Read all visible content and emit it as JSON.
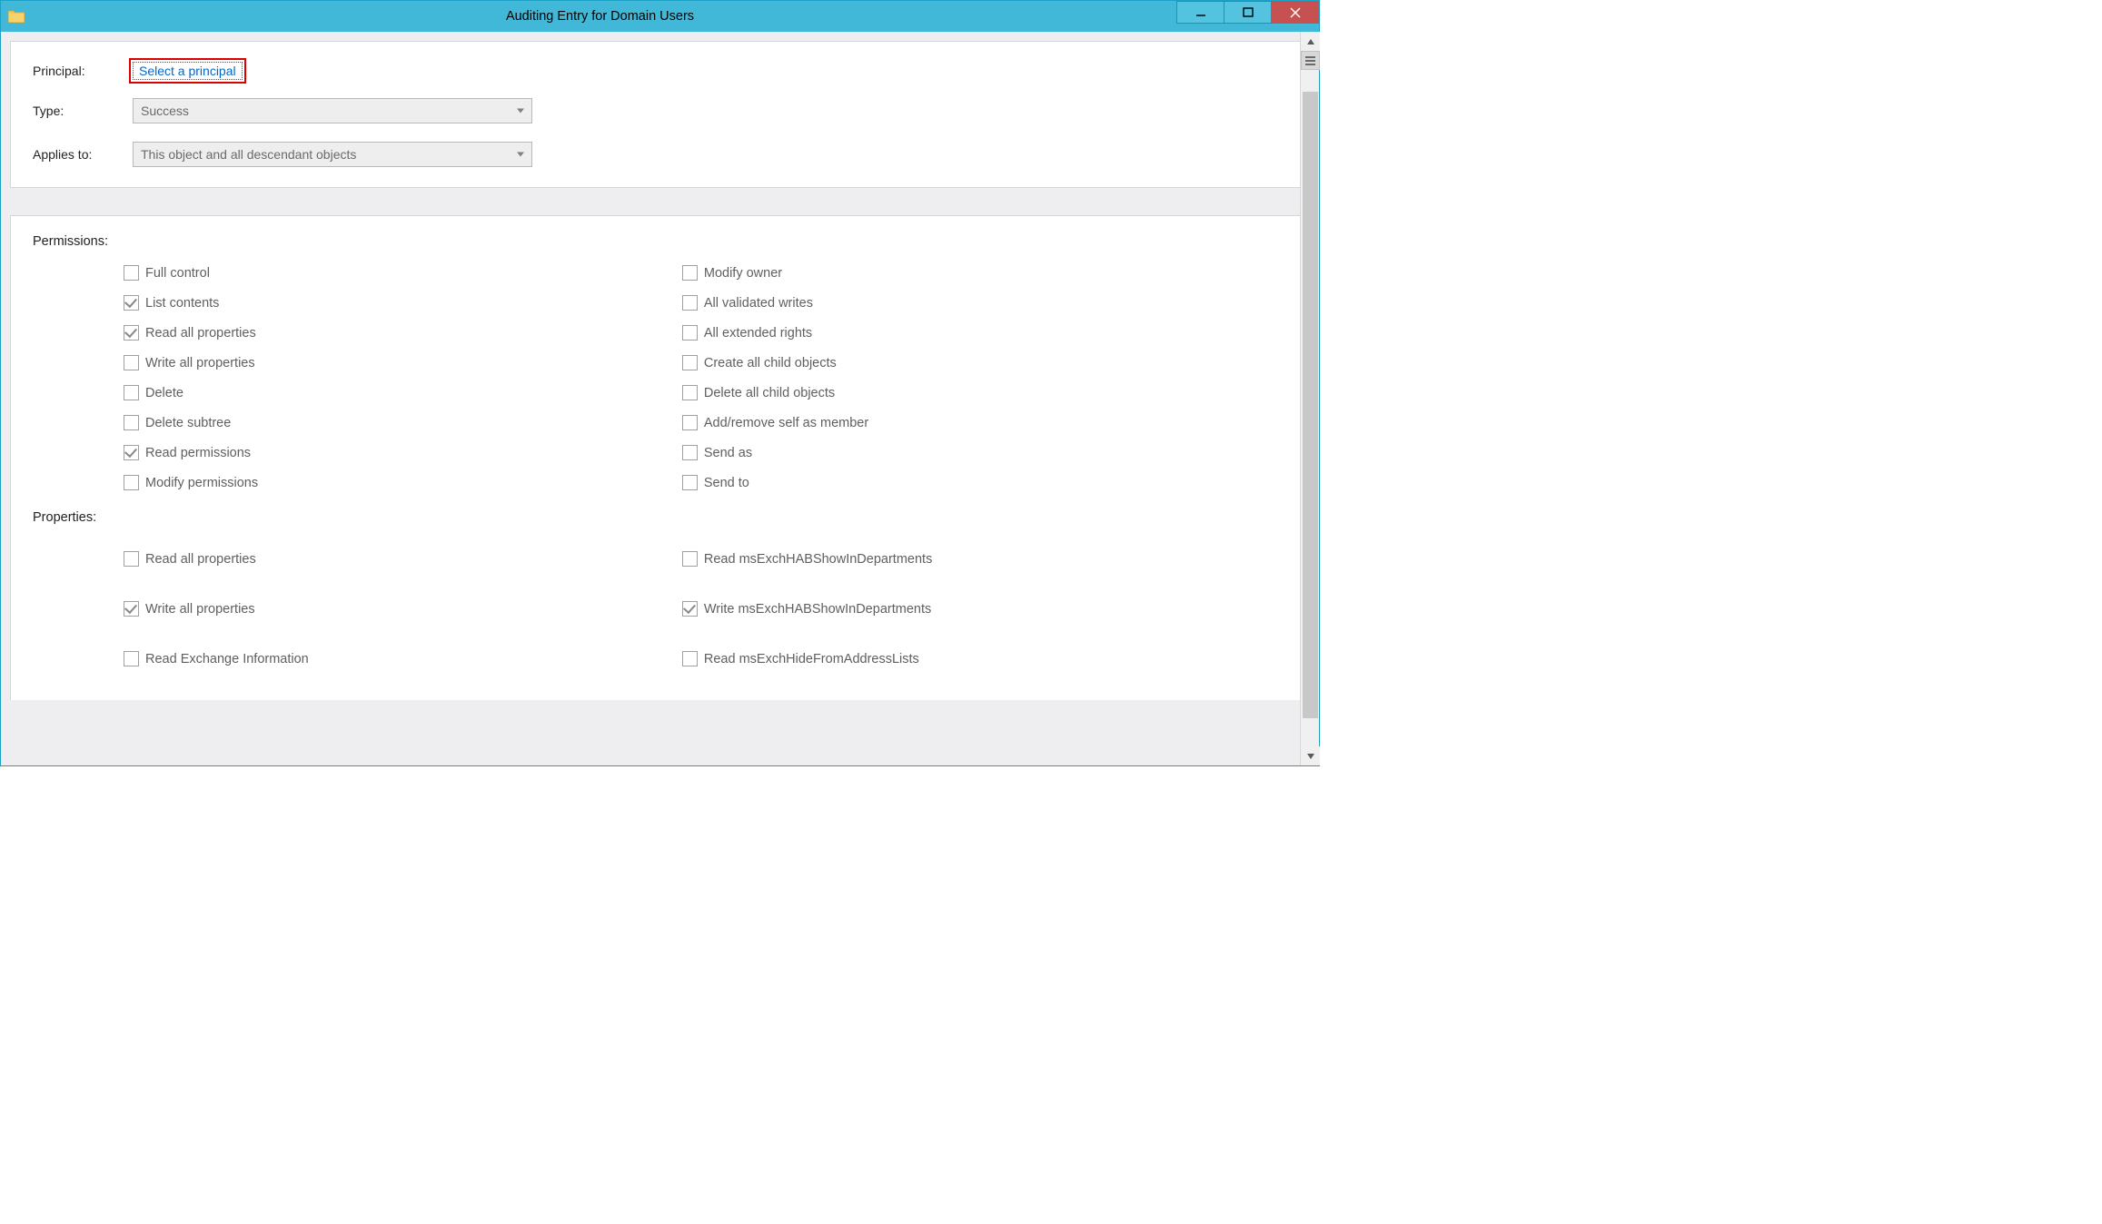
{
  "window": {
    "title": "Auditing Entry for Domain Users"
  },
  "principal": {
    "label": "Principal:",
    "link": "Select a principal"
  },
  "type": {
    "label": "Type:",
    "value": "Success"
  },
  "applies": {
    "label": "Applies to:",
    "value": "This object and all descendant objects"
  },
  "permissions": {
    "heading": "Permissions:",
    "left": [
      {
        "label": "Full control",
        "checked": false
      },
      {
        "label": "List contents",
        "checked": true
      },
      {
        "label": "Read all properties",
        "checked": true
      },
      {
        "label": "Write all properties",
        "checked": false
      },
      {
        "label": "Delete",
        "checked": false
      },
      {
        "label": "Delete subtree",
        "checked": false
      },
      {
        "label": "Read permissions",
        "checked": true
      },
      {
        "label": "Modify permissions",
        "checked": false
      }
    ],
    "right": [
      {
        "label": "Modify owner",
        "checked": false
      },
      {
        "label": "All validated writes",
        "checked": false
      },
      {
        "label": "All extended rights",
        "checked": false
      },
      {
        "label": "Create all child objects",
        "checked": false
      },
      {
        "label": "Delete all child objects",
        "checked": false
      },
      {
        "label": "Add/remove self as member",
        "checked": false
      },
      {
        "label": "Send as",
        "checked": false
      },
      {
        "label": "Send to",
        "checked": false
      }
    ]
  },
  "properties": {
    "heading": "Properties:",
    "left": [
      {
        "label": "Read all properties",
        "checked": false
      },
      {
        "label": "Write all properties",
        "checked": true
      },
      {
        "label": "Read Exchange Information",
        "checked": false
      }
    ],
    "right": [
      {
        "label": "Read msExchHABShowInDepartments",
        "checked": false
      },
      {
        "label": "Write msExchHABShowInDepartments",
        "checked": true
      },
      {
        "label": "Read msExchHideFromAddressLists",
        "checked": false
      }
    ]
  }
}
